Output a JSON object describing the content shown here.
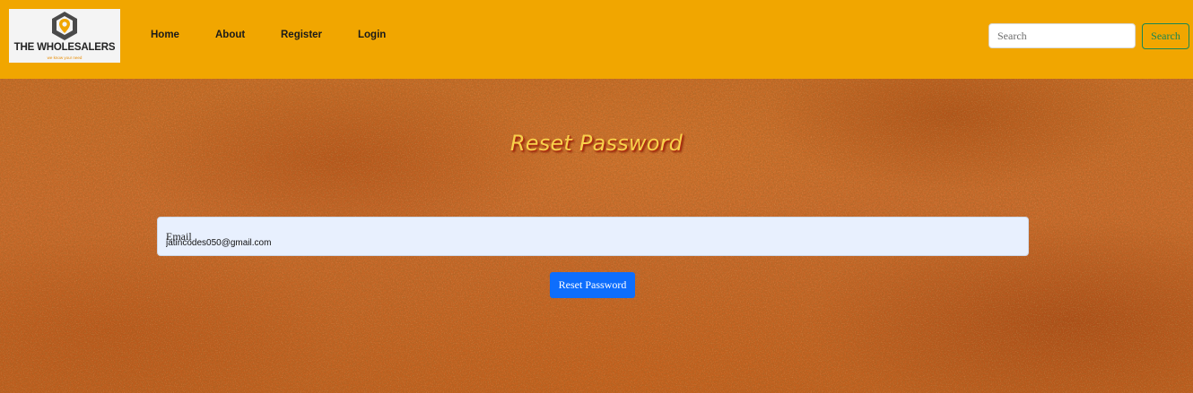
{
  "brand": {
    "name": "THE WHOLESALERS",
    "tagline": "we know your need",
    "logo_icon": "hexagon-location-pin-icon",
    "colors": {
      "mark_dark": "#4a4a4a",
      "mark_accent": "#f1a600"
    }
  },
  "nav": {
    "items": [
      {
        "label": "Home"
      },
      {
        "label": "About"
      },
      {
        "label": "Register"
      },
      {
        "label": "Login"
      }
    ]
  },
  "search": {
    "placeholder": "Search",
    "value": "",
    "button_label": "Search"
  },
  "main": {
    "title": "Reset Password",
    "email_label": "Email",
    "email_value": "jatincodes050@gmail.com",
    "submit_label": "Reset Password"
  },
  "colors": {
    "navbar": "#f1a600",
    "title_text": "#f7d14b",
    "title_shadow": "#b32a10",
    "input_background": "#e8f0fe",
    "primary_button": "#0d6efd",
    "search_button": "#198754",
    "background_texture": "#c0621c"
  }
}
